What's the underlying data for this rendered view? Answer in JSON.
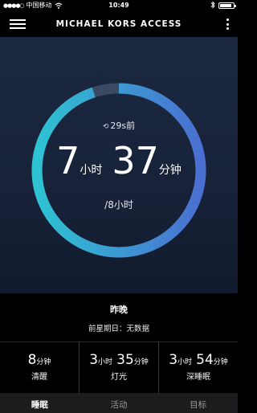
{
  "status_bar": {
    "signal": "●●●●○",
    "carrier": "中国移动",
    "wifi_icon": "wifi-icon",
    "time": "10:49",
    "bluetooth_icon": "bluetooth-icon",
    "battery_level": 0.85
  },
  "header": {
    "brand": "MICHAEL KORS ACCESS",
    "menu_icon": "hamburger-menu-icon",
    "more_icon": "more-vertical-icon"
  },
  "sleep_ring": {
    "synced_icon": "sync-icon",
    "synced_ago": "29s前",
    "hours": "7",
    "hours_unit": "小时",
    "minutes": "37",
    "minutes_unit": "分钟",
    "goal": "/8小时",
    "progress": 0.95,
    "colors": {
      "start": "#2ec3d3",
      "end": "#4a6fd1",
      "track": "#3a4a63"
    }
  },
  "summary": {
    "title": "昨晚",
    "subtitle": "前星期日：无数据"
  },
  "stats": [
    {
      "parts": [
        {
          "n": "8",
          "u": "分钟"
        }
      ],
      "label": "清醒"
    },
    {
      "parts": [
        {
          "n": "3",
          "u": "小时"
        },
        {
          "n": "35",
          "u": "分钟"
        }
      ],
      "label": "灯光"
    },
    {
      "parts": [
        {
          "n": "3",
          "u": "小时"
        },
        {
          "n": "54",
          "u": "分钟"
        }
      ],
      "label": "深睡眠"
    }
  ],
  "tabs": [
    {
      "label": "睡眠",
      "active": true
    },
    {
      "label": "活动",
      "active": false
    },
    {
      "label": "目标",
      "active": false
    }
  ]
}
